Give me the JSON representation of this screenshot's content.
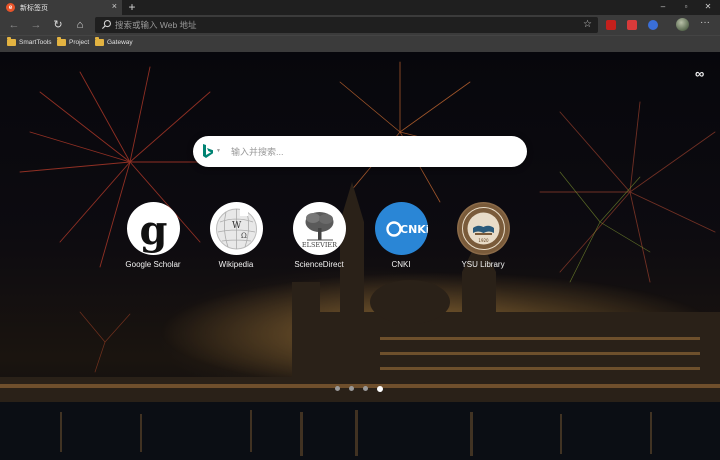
{
  "tab": {
    "title": "新标签页",
    "close": "×",
    "new_tab": "+"
  },
  "window_controls": {
    "minimize": "–",
    "maximize": "▫",
    "close": "✕"
  },
  "nav": {
    "back": "←",
    "forward": "→",
    "refresh": "↻",
    "home": "⌂"
  },
  "address_bar": {
    "placeholder": "搜索或输入 Web 地址",
    "star": "☆"
  },
  "more_label": "···",
  "bookmarks": [
    {
      "label": "SmartTools"
    },
    {
      "label": "Project"
    },
    {
      "label": "Gateway"
    }
  ],
  "customize_icon": "∞",
  "search": {
    "placeholder": "输入并搜索...",
    "caret": "▼"
  },
  "tiles": [
    {
      "label": "Google Scholar"
    },
    {
      "label": "Wikipedia"
    },
    {
      "label": "ScienceDirect"
    },
    {
      "label": "CNKI",
      "logo_text": "CNKi"
    },
    {
      "label": "YSU Library",
      "logo_text": "1920"
    }
  ],
  "elsevier_text": "ELSEVIER",
  "colors": {
    "tab_bg": "#3b3b3b",
    "titlebar_bg": "#1f1f1f",
    "cnki_blue": "#2a86d6",
    "bing_blue": "#008373",
    "folder_yellow": "#e3b341",
    "ysu_brown": "#7a5b3a"
  },
  "pager": {
    "count": 4,
    "active": 3
  }
}
